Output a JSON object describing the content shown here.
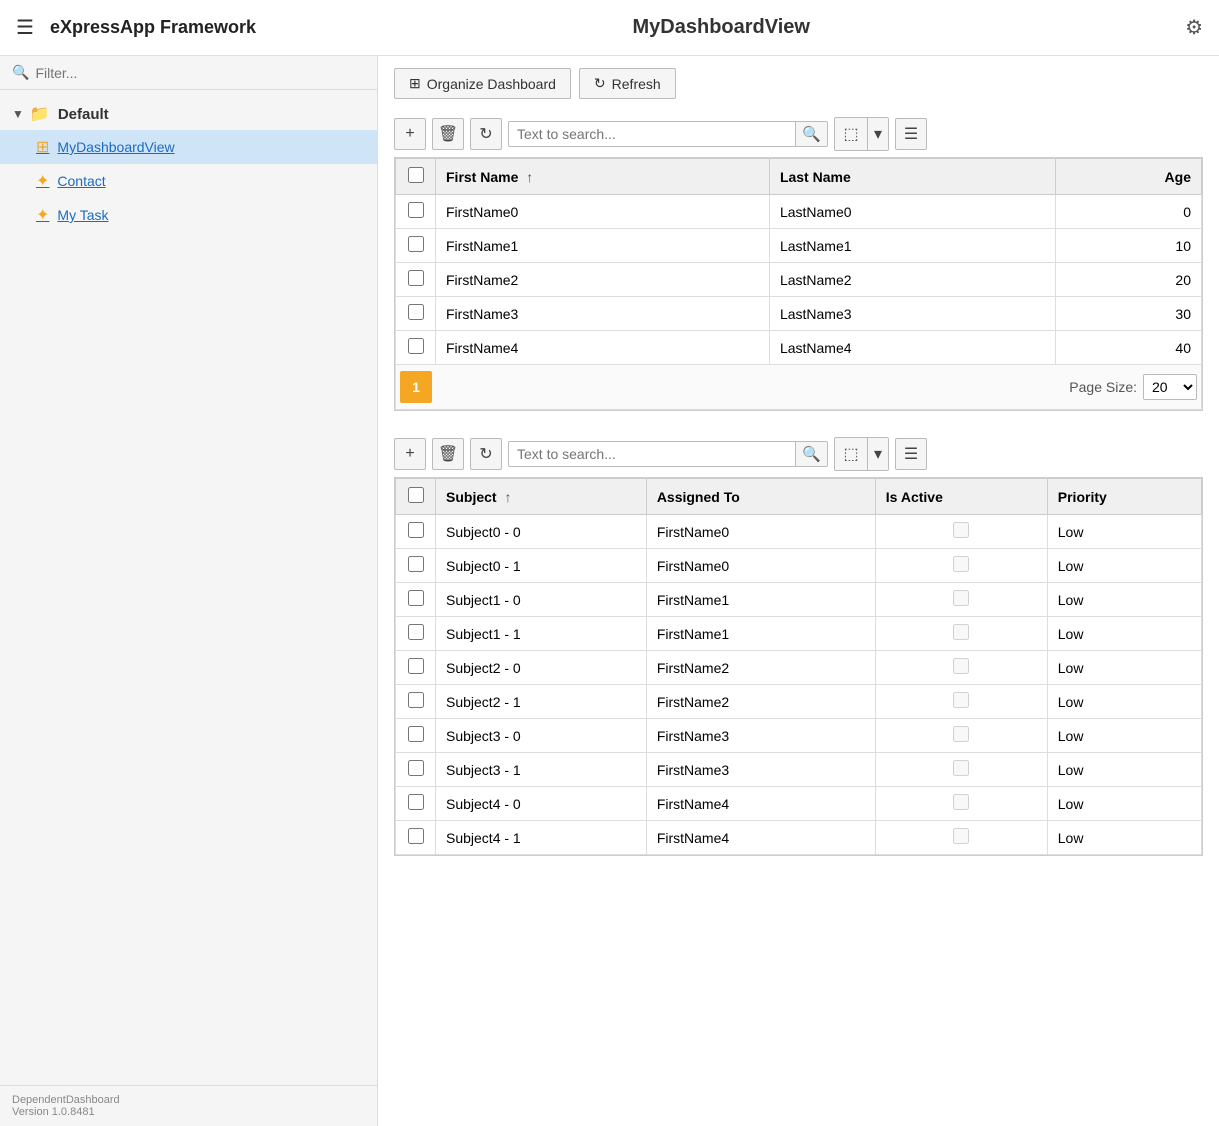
{
  "header": {
    "app_title": "eXpressApp Framework",
    "page_title": "MyDashboardView"
  },
  "sidebar": {
    "filter_placeholder": "Filter...",
    "tree": {
      "group_label": "Default",
      "items": [
        {
          "id": "mydashboardview",
          "label": "MyDashboardView",
          "active": true
        },
        {
          "id": "contact",
          "label": "Contact",
          "active": false
        },
        {
          "id": "mytask",
          "label": "My Task",
          "active": false
        }
      ]
    },
    "footer": {
      "line1": "DependentDashboard",
      "line2": "Version 1.0.8481"
    }
  },
  "toolbar_buttons": {
    "organize": "Organize Dashboard",
    "refresh": "Refresh"
  },
  "grid1": {
    "search_placeholder": "Text to search...",
    "columns": [
      "First Name",
      "Last Name",
      "Age"
    ],
    "rows": [
      {
        "first_name": "FirstName0",
        "last_name": "LastName0",
        "age": "0"
      },
      {
        "first_name": "FirstName1",
        "last_name": "LastName1",
        "age": "10"
      },
      {
        "first_name": "FirstName2",
        "last_name": "LastName2",
        "age": "20"
      },
      {
        "first_name": "FirstName3",
        "last_name": "LastName3",
        "age": "30"
      },
      {
        "first_name": "FirstName4",
        "last_name": "LastName4",
        "age": "40"
      }
    ],
    "page_current": "1",
    "page_size_label": "Page Size:",
    "page_size_value": "20"
  },
  "grid2": {
    "search_placeholder": "Text to search...",
    "columns": [
      "Subject",
      "Assigned To",
      "Is Active",
      "Priority"
    ],
    "rows": [
      {
        "subject": "Subject0 - 0",
        "assigned_to": "FirstName0",
        "priority": "Low"
      },
      {
        "subject": "Subject0 - 1",
        "assigned_to": "FirstName0",
        "priority": "Low"
      },
      {
        "subject": "Subject1 - 0",
        "assigned_to": "FirstName1",
        "priority": "Low"
      },
      {
        "subject": "Subject1 - 1",
        "assigned_to": "FirstName1",
        "priority": "Low"
      },
      {
        "subject": "Subject2 - 0",
        "assigned_to": "FirstName2",
        "priority": "Low"
      },
      {
        "subject": "Subject2 - 1",
        "assigned_to": "FirstName2",
        "priority": "Low"
      },
      {
        "subject": "Subject3 - 0",
        "assigned_to": "FirstName3",
        "priority": "Low"
      },
      {
        "subject": "Subject3 - 1",
        "assigned_to": "FirstName3",
        "priority": "Low"
      },
      {
        "subject": "Subject4 - 0",
        "assigned_to": "FirstName4",
        "priority": "Low"
      },
      {
        "subject": "Subject4 - 1",
        "assigned_to": "FirstName4",
        "priority": "Low"
      }
    ]
  },
  "icons": {
    "hamburger": "☰",
    "gear": "⚙",
    "search": "🔍",
    "folder": "📁",
    "chevron_down": "▼",
    "star_gear": "✦",
    "plus": "+",
    "trash": "🗑",
    "refresh": "↻",
    "search_mag": "🔍",
    "export": "⬚",
    "column_chooser": "☰",
    "sort_asc": "↑",
    "organize_icon": "⊞"
  }
}
